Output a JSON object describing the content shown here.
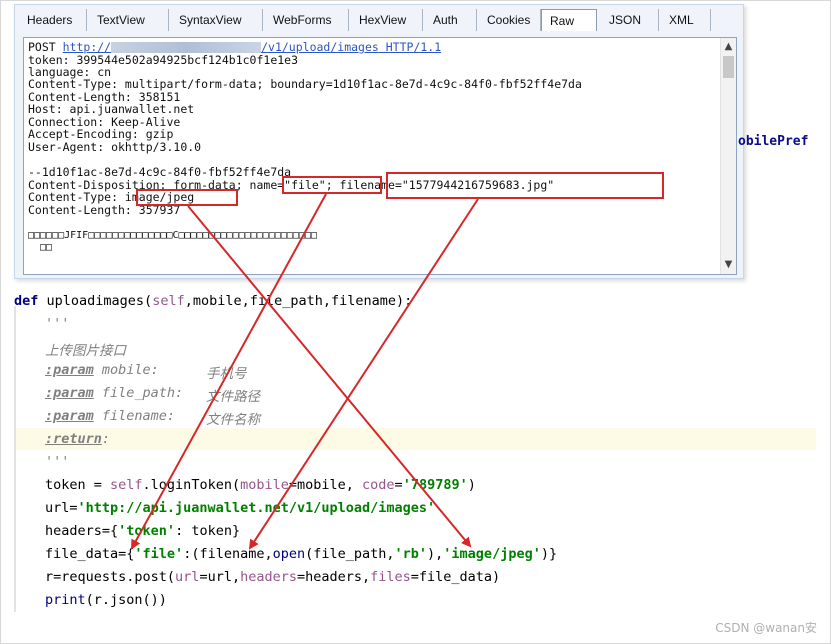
{
  "tabs": [
    "Headers",
    "TextView",
    "SyntaxView",
    "WebForms",
    "HexView",
    "Auth",
    "Cookies",
    "Raw",
    "JSON",
    "XML"
  ],
  "active_tab": "Raw",
  "raw": {
    "request_method": "POST",
    "url_prefix": "http://",
    "url_suffix": "/v1/upload/images",
    "http_version": "HTTP/1.1",
    "lines": [
      "token: 399544e502a94925bcf124b1c0f1e1e3",
      "language: cn",
      "Content-Type: multipart/form-data; boundary=1d10f1ac-8e7d-4c9c-84f0-fbf52ff4e7da",
      "Content-Length: 358151",
      "Host: api.juanwallet.net",
      "Connection: Keep-Alive",
      "Accept-Encoding: gzip",
      "User-Agent: okhttp/3.10.0",
      "",
      "--1d10f1ac-8e7d-4c9c-84f0-fbf52ff4e7da",
      "Content-Disposition: form-data; name=\"file\"; filename=\"1577944216759683.jpg\"",
      "Content-Type: image/jpeg",
      "Content-Length: 357937",
      "",
      "□□□□□□JFIF□□□□□□□□□□□□□□C□□□□□□□□□□□□□□□□□□□□□□□",
      "  □□"
    ]
  },
  "side_text": "obilePref",
  "code": {
    "def_line": {
      "kw": "def",
      "name": " uploadimages(",
      "self": "self",
      "rest": ",mobile,file_path,filename):"
    },
    "doc_open": "'''",
    "doc_title": "上传图片接口",
    "params": [
      {
        "tag": ":param",
        "name": " mobile:",
        "desc": "手机号"
      },
      {
        "tag": ":param",
        "name": " file_path:",
        "desc": "文件路径"
      },
      {
        "tag": ":param",
        "name": " filename:",
        "desc": "文件名称"
      }
    ],
    "return_tag": ":return",
    "return_colon": ":",
    "doc_close": "'''",
    "token_line": {
      "a": "token = ",
      "self": "self",
      "b": ".loginToken(",
      "p1": "mobile",
      "c": "=mobile, ",
      "p2": "code",
      "d": "=",
      "s": "'789789'",
      "e": ")"
    },
    "url_line": {
      "a": "url=",
      "s": "'http://api.juanwallet.net/v1/upload/images'"
    },
    "headers_line": {
      "a": "headers={",
      "s": "'token'",
      "b": ": token}"
    },
    "file_line": {
      "a": "file_data={",
      "s1": "'file'",
      "b": ":(filename,",
      "kw": "open",
      "c": "(file_path,",
      "s2": "'rb'",
      "d": "),",
      "s3": "'image/jpeg'",
      "e": ")}"
    },
    "req_line": {
      "a": "r=requests.post(",
      "p1": "url",
      "b": "=url,",
      "p2": "headers",
      "c": "=headers,",
      "p3": "files",
      "d": "=file_data)"
    },
    "print_line": {
      "kw": "print",
      "a": "(r.json())"
    }
  },
  "watermark": "CSDN @wanan安",
  "colors": {
    "annotation": "#d62828",
    "keyword": "#000080",
    "string": "#008000",
    "self": "#94558d"
  }
}
